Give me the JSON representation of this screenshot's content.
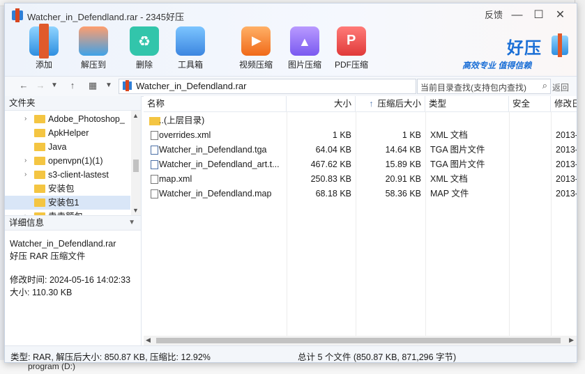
{
  "window": {
    "title": "Watcher_in_Defendland.rar - 2345好压",
    "feedback_label": "反馈",
    "minimize_label": "—",
    "maximize_label": "☐",
    "close_label": "✕"
  },
  "toolbar": {
    "add": "添加",
    "extract": "解压到",
    "delete": "删除",
    "toolbox": "工具箱",
    "video": "视频压缩",
    "image": "图片压缩",
    "pdf": "PDF压缩"
  },
  "brand": {
    "name": "好压",
    "slogan": "高效专业 值得信赖"
  },
  "nav": {
    "address": "Watcher_in_Defendland.rar",
    "search_placeholder": "当前目录查找(支持包内查找)",
    "back_label": "返回"
  },
  "left": {
    "folder_header": "文件夹",
    "tree": [
      {
        "label": "Adobe_Photoshop_",
        "arrow": "›"
      },
      {
        "label": "ApkHelper",
        "arrow": ""
      },
      {
        "label": "Java",
        "arrow": ""
      },
      {
        "label": "openvpn(1)(1)",
        "arrow": "›"
      },
      {
        "label": "s3-client-lastest",
        "arrow": "›"
      },
      {
        "label": "安装包",
        "arrow": ""
      },
      {
        "label": "安装包1",
        "arrow": ""
      },
      {
        "label": "卖卖额包",
        "arrow": "›"
      }
    ],
    "detail_header": "详细信息",
    "detail_name": "Watcher_in_Defendland.rar",
    "detail_type": "好压 RAR 压缩文件",
    "detail_mtime": "修改时间:  2024-05-16 14:02:33",
    "detail_size": "大小:  110.30 KB"
  },
  "columns": {
    "name": "名称",
    "size": "大小",
    "compressed": "压缩后大小",
    "sort_arrow": "↑",
    "type": "类型",
    "security": "安全",
    "modified": "修改日"
  },
  "files": [
    {
      "name": "..(上层目录)",
      "size": "",
      "compressed": "",
      "type": "",
      "modified": "",
      "icon": "up"
    },
    {
      "name": "overrides.xml",
      "size": "1 KB",
      "compressed": "1 KB",
      "type": "XML 文档",
      "modified": "2013-",
      "icon": "doc"
    },
    {
      "name": "Watcher_in_Defendland.tga",
      "size": "64.04 KB",
      "compressed": "14.64 KB",
      "type": "TGA 图片文件",
      "modified": "2013-",
      "icon": "img"
    },
    {
      "name": "Watcher_in_Defendland_art.t...",
      "size": "467.62 KB",
      "compressed": "15.89 KB",
      "type": "TGA 图片文件",
      "modified": "2013-",
      "icon": "img"
    },
    {
      "name": "map.xml",
      "size": "250.83 KB",
      "compressed": "20.91 KB",
      "type": "XML 文档",
      "modified": "2013-",
      "icon": "doc"
    },
    {
      "name": "Watcher_in_Defendland.map",
      "size": "68.18 KB",
      "compressed": "58.36 KB",
      "type": "MAP 文件",
      "modified": "2013-",
      "icon": "doc"
    }
  ],
  "status": {
    "left": "类型: RAR, 解压后大小: 850.87 KB, 压缩比: 12.92%",
    "right": "总计 5 个文件 (850.87 KB, 871,296 字节)"
  },
  "background": {
    "drive_label": "program (D:)"
  }
}
